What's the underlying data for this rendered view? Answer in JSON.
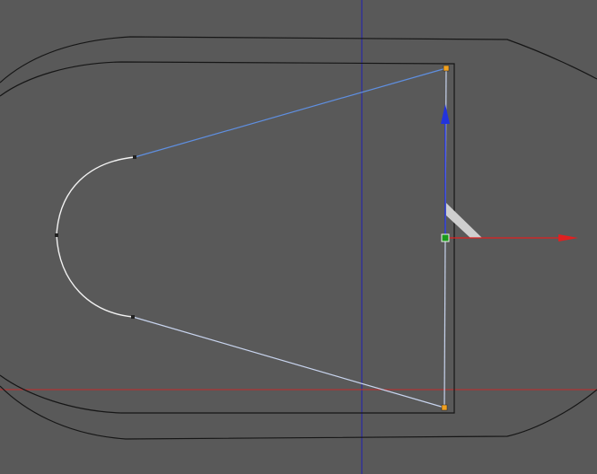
{
  "viewport": {
    "background_color": "#595959",
    "guide_colors": {
      "vertical_axis": "#1f1fb3",
      "horizontal_axis": "#c42a2a"
    }
  },
  "scene": {
    "outline_color": "#161616",
    "selected_curve_color": "#5f8fe0",
    "selected_curve_light_color": "#c8d4ee",
    "arc_color": "#f2f2f2",
    "control_point_color": "#f0a020"
  },
  "gizmo": {
    "y_axis_color": "#2233dd",
    "x_axis_color": "#e02020",
    "pivot_color": "#1a9a1a",
    "plane_handle_color": "#cfcfcf"
  }
}
